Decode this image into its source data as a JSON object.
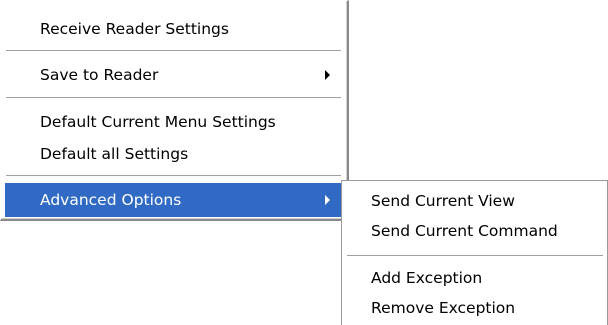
{
  "main_menu": {
    "items": [
      {
        "label": "Receive Reader Settings"
      },
      {
        "label": "Save to Reader"
      },
      {
        "label": "Default Current Menu Settings"
      },
      {
        "label": "Default all Settings"
      },
      {
        "label": "Advanced Options"
      }
    ]
  },
  "sub_menu": {
    "items": [
      {
        "label": "Send Current View"
      },
      {
        "label": "Send Current Command"
      },
      {
        "label": "Add Exception"
      },
      {
        "label": "Remove Exception"
      }
    ]
  },
  "colors": {
    "highlight": "#316ac5",
    "highlight_text": "#ffffff",
    "menu_background": "#ffffff"
  }
}
